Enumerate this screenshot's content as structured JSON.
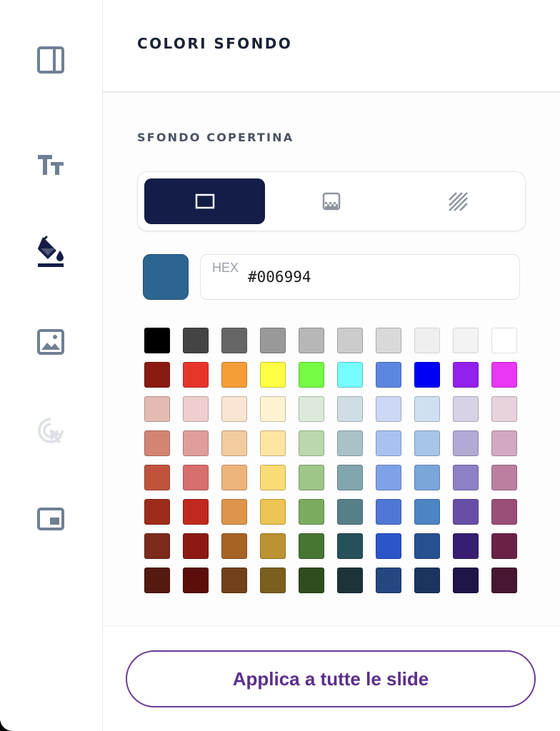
{
  "header": {
    "title": "COLORI SFONDO"
  },
  "sidebar": {
    "items": [
      {
        "name": "layout",
        "icon": "panel-layout-icon",
        "active": false
      },
      {
        "name": "text",
        "icon": "text-size-icon",
        "active": false
      },
      {
        "name": "background",
        "icon": "paint-bucket-icon",
        "active": true
      },
      {
        "name": "image",
        "icon": "image-icon",
        "active": false
      },
      {
        "name": "interaction",
        "icon": "cursor-click-icon",
        "active": false,
        "disabled": true
      },
      {
        "name": "picture-in-picture",
        "icon": "picture-in-picture-icon",
        "active": false
      }
    ]
  },
  "section": {
    "title": "SFONDO COPERTINA",
    "fill_types": [
      {
        "name": "solid",
        "icon": "solid-rectangle-icon",
        "active": true
      },
      {
        "name": "gradient",
        "icon": "gradient-icon",
        "active": false
      },
      {
        "name": "pattern",
        "icon": "pattern-stripes-icon",
        "active": false
      }
    ],
    "current_color": "#2c6690",
    "hex": {
      "label": "HEX",
      "value": "#006994"
    }
  },
  "palette": [
    [
      "#000000",
      "#444444",
      "#666666",
      "#999999",
      "#b7b7b7",
      "#cccccc",
      "#d9d9d9",
      "#efefef",
      "#f3f3f3",
      "#ffffff"
    ],
    [
      "#8b1b12",
      "#e8352a",
      "#f59e38",
      "#ffff45",
      "#76fc44",
      "#78fdfe",
      "#5b87e0",
      "#0000f5",
      "#9220ee",
      "#e937f4"
    ],
    [
      "#e2bcb2",
      "#efcfce",
      "#f9e5d1",
      "#fef3d1",
      "#ddeadb",
      "#d0dee3",
      "#cdd9f4",
      "#d0e0f1",
      "#d8d2e6",
      "#e8d2dd"
    ],
    [
      "#d48473",
      "#e09d9c",
      "#f2cb9f",
      "#fce6a1",
      "#bbd8ad",
      "#a9c2c7",
      "#a8c1f1",
      "#a7c5e6",
      "#b3a9d5",
      "#d2a9c1"
    ],
    [
      "#c1533c",
      "#d66f6d",
      "#edb47a",
      "#fbdb75",
      "#9ec58a",
      "#82a6ae",
      "#7ea1e7",
      "#7ba6da",
      "#8f7fc5",
      "#bb7f9f"
    ],
    [
      "#9e2c1a",
      "#c0291f",
      "#de9449",
      "#ecc454",
      "#7aab5f",
      "#568088",
      "#4f78d5",
      "#4d85c4",
      "#674fa8",
      "#9b4e77"
    ],
    [
      "#7c2a1b",
      "#8c1a12",
      "#a76226",
      "#bb9332",
      "#477532",
      "#26505a",
      "#2b55c9",
      "#265090",
      "#381e72",
      "#6b2146"
    ],
    [
      "#551a0f",
      "#5c0f0a",
      "#714219",
      "#7a5f1e",
      "#2f4d1f",
      "#1a3439",
      "#264682",
      "#1c355e",
      "#201449",
      "#471630"
    ]
  ],
  "footer": {
    "apply_label": "Applica a tutte le slide"
  }
}
